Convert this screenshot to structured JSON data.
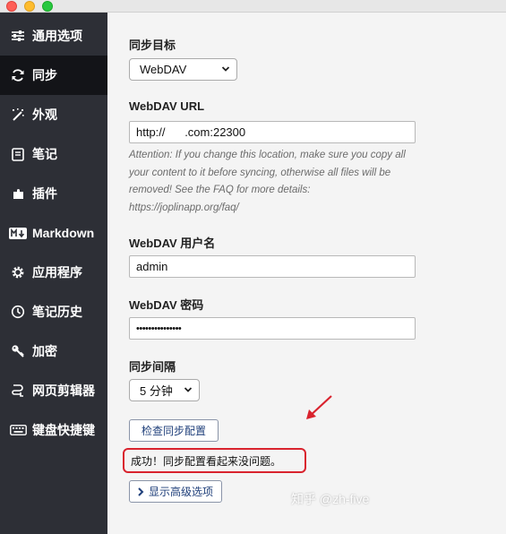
{
  "window": {
    "controls": [
      "close",
      "minimize",
      "zoom"
    ]
  },
  "sidebar": {
    "items": [
      {
        "label": "通用选项",
        "icon": "sliders-icon",
        "active": false
      },
      {
        "label": "同步",
        "icon": "sync-icon",
        "active": true
      },
      {
        "label": "外观",
        "icon": "magic-wand-icon",
        "active": false
      },
      {
        "label": "笔记",
        "icon": "note-icon",
        "active": false
      },
      {
        "label": "插件",
        "icon": "puzzle-icon",
        "active": false
      },
      {
        "label": "Markdown",
        "icon": "markdown-icon",
        "active": false
      },
      {
        "label": "应用程序",
        "icon": "gear-icon",
        "active": false
      },
      {
        "label": "笔记历史",
        "icon": "history-icon",
        "active": false
      },
      {
        "label": "加密",
        "icon": "key-icon",
        "active": false
      },
      {
        "label": "网页剪辑器",
        "icon": "clipper-icon",
        "active": false
      },
      {
        "label": "键盘快捷键",
        "icon": "keyboard-icon",
        "active": false
      }
    ]
  },
  "sync": {
    "target_label": "同步目标",
    "target_value": "WebDAV",
    "url_label": "WebDAV URL",
    "url_value": "http://      .com:22300",
    "hint": "Attention: If you change this location, make sure you copy all your content to it before syncing, otherwise all files will be removed! See the FAQ for more details: https://joplinapp.org/faq/",
    "username_label": "WebDAV 用户名",
    "username_value": "admin",
    "password_label": "WebDAV 密码",
    "password_value": "•••••••••••••••",
    "interval_label": "同步间隔",
    "interval_value": "5 分钟",
    "check_button": "检查同步配置",
    "status_text": "成功！同步配置看起来没问题。",
    "advanced_button": "显示高级选项"
  },
  "watermark": "知乎 @zh-five",
  "colors": {
    "sidebar": "#2d2f36",
    "sidebar_active": "#131418",
    "annotation": "#d9232e"
  }
}
